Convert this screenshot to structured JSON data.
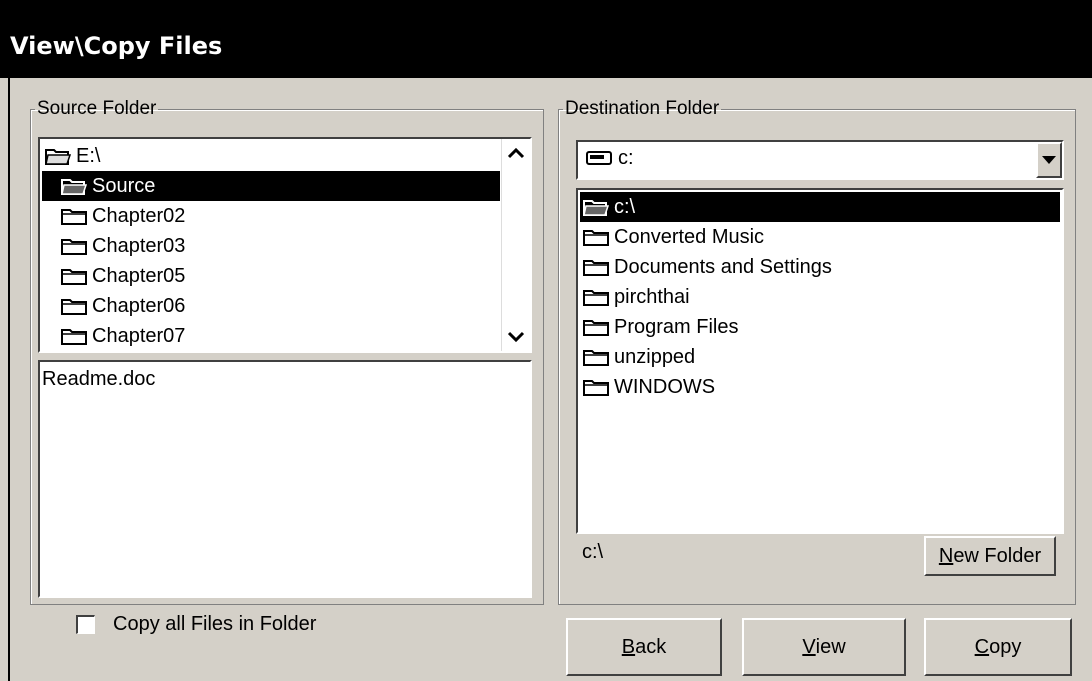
{
  "window": {
    "title": "View\\Copy Files"
  },
  "source": {
    "group_label": "Source Folder",
    "tree": [
      {
        "label": "E:\\",
        "icon": "open-folder-icon",
        "indent": 0,
        "selected": false
      },
      {
        "label": "Source",
        "icon": "open-folder-icon",
        "indent": 1,
        "selected": true
      },
      {
        "label": "Chapter02",
        "icon": "folder-icon",
        "indent": 1,
        "selected": false
      },
      {
        "label": "Chapter03",
        "icon": "folder-icon",
        "indent": 1,
        "selected": false
      },
      {
        "label": "Chapter05",
        "icon": "folder-icon",
        "indent": 1,
        "selected": false
      },
      {
        "label": "Chapter06",
        "icon": "folder-icon",
        "indent": 1,
        "selected": false
      },
      {
        "label": "Chapter07",
        "icon": "folder-icon",
        "indent": 1,
        "selected": false
      }
    ],
    "files": [
      "Readme.doc"
    ],
    "copy_all_label": "Copy all Files in Folder",
    "copy_all_checked": false
  },
  "destination": {
    "group_label": "Destination Folder",
    "drive_value": "c:",
    "tree": [
      {
        "label": "c:\\",
        "icon": "open-folder-icon",
        "indent": 0,
        "selected": true
      },
      {
        "label": "Converted Music",
        "icon": "folder-icon",
        "indent": 0,
        "selected": false
      },
      {
        "label": "Documents and Settings",
        "icon": "folder-icon",
        "indent": 0,
        "selected": false
      },
      {
        "label": "pirchthai",
        "icon": "folder-icon",
        "indent": 0,
        "selected": false
      },
      {
        "label": "Program Files",
        "icon": "folder-icon",
        "indent": 0,
        "selected": false
      },
      {
        "label": "unzipped",
        "icon": "folder-icon",
        "indent": 0,
        "selected": false
      },
      {
        "label": "WINDOWS",
        "icon": "folder-icon",
        "indent": 0,
        "selected": false
      }
    ],
    "current_path": "c:\\",
    "new_folder": {
      "mnemonic": "N",
      "rest": "ew Folder"
    }
  },
  "buttons": {
    "back": {
      "mnemonic": "B",
      "rest": "ack"
    },
    "view": {
      "mnemonic": "V",
      "rest": "iew"
    },
    "copy": {
      "mnemonic": "C",
      "rest": "opy"
    }
  },
  "colors": {
    "face": "#d4d0c8",
    "title_bg": "#000000",
    "selection": "#000000"
  }
}
